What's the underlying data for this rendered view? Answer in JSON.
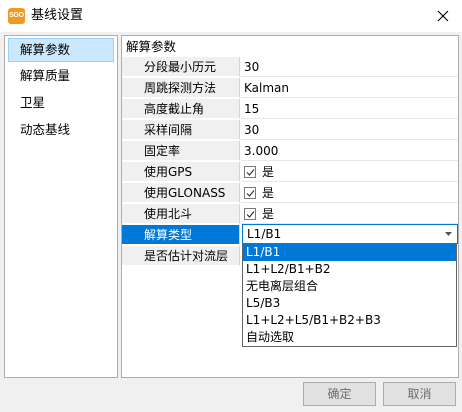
{
  "window": {
    "title": "基线设置",
    "app_icon_text": "SGO",
    "app_icon_color": "#f39a1e"
  },
  "sidebar": {
    "items": [
      {
        "label": "解算参数",
        "selected": true
      },
      {
        "label": "解算质量"
      },
      {
        "label": "卫星"
      },
      {
        "label": "动态基线"
      }
    ]
  },
  "main": {
    "group_title": "解算参数",
    "rows": [
      {
        "name": "分段最小历元",
        "value": "30"
      },
      {
        "name": "周跳探测方法",
        "value": "Kalman"
      },
      {
        "name": "高度截止角",
        "value": "15"
      },
      {
        "name": "采样间隔",
        "value": "30"
      },
      {
        "name": "固定率",
        "value": "3.000"
      },
      {
        "name": "使用GPS",
        "value": "是",
        "checked": true
      },
      {
        "name": "使用GLONASS",
        "value": "是",
        "checked": true
      },
      {
        "name": "使用北斗",
        "value": "是",
        "checked": true
      },
      {
        "name": "解算类型",
        "value": "L1/B1",
        "selected": true
      },
      {
        "name": "是否估计对流层",
        "value": ""
      }
    ]
  },
  "dropdown": {
    "options": [
      "L1/B1",
      "L1+L2/B1+B2",
      "无电离层组合",
      "L5/B3",
      "L1+L2+L5/B1+B2+B3",
      "自动选取"
    ],
    "selected": "L1/B1"
  },
  "buttons": {
    "ok": "确定",
    "cancel": "取消"
  },
  "colors": {
    "selection": "#0078d7",
    "sidebar_selection": "#cce8ff"
  }
}
